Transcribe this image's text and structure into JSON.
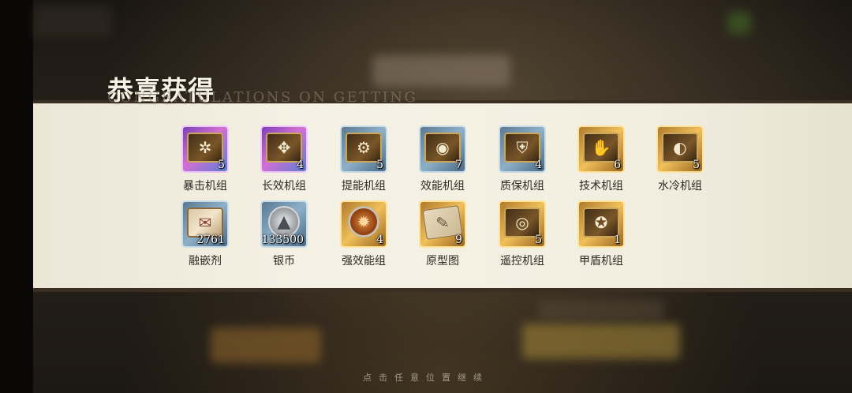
{
  "header": {
    "title": "恭喜获得",
    "subtitle": "CONGRATULATIONS ON GETTING"
  },
  "rewards": [
    {
      "name": "暴击机组",
      "count": "5",
      "rarity": "purple",
      "icon": "critical-module-icon",
      "glyph": "✲"
    },
    {
      "name": "长效机组",
      "count": "4",
      "rarity": "purple",
      "icon": "longevity-module-icon",
      "glyph": "✥"
    },
    {
      "name": "提能机组",
      "count": "5",
      "rarity": "blue",
      "icon": "boost-module-icon",
      "glyph": "⚙"
    },
    {
      "name": "效能机组",
      "count": "7",
      "rarity": "blue",
      "icon": "efficiency-module-icon",
      "glyph": "◉"
    },
    {
      "name": "质保机组",
      "count": "4",
      "rarity": "blue",
      "icon": "warranty-module-icon",
      "glyph": "⛨"
    },
    {
      "name": "技术机组",
      "count": "6",
      "rarity": "gold",
      "icon": "tech-module-icon",
      "glyph": "✋"
    },
    {
      "name": "水冷机组",
      "count": "5",
      "rarity": "gold",
      "icon": "watercool-module-icon",
      "glyph": "◐"
    },
    {
      "name": "融嵌剂",
      "count": "2761",
      "rarity": "blue",
      "icon": "fusion-agent-scroll-icon",
      "glyph": "✉"
    },
    {
      "name": "银币",
      "count": "133500",
      "rarity": "blue",
      "icon": "silver-coin-icon",
      "glyph": "▲"
    },
    {
      "name": "强效能组",
      "count": "4",
      "rarity": "gold",
      "icon": "strong-efficiency-gear-icon",
      "glyph": "✹"
    },
    {
      "name": "原型图",
      "count": "9",
      "rarity": "gold",
      "icon": "blueprint-icon",
      "glyph": "✎"
    },
    {
      "name": "遥控机组",
      "count": "5",
      "rarity": "gold",
      "icon": "remote-module-icon",
      "glyph": "◎"
    },
    {
      "name": "甲盾机组",
      "count": "1",
      "rarity": "gold",
      "icon": "armor-shield-module-icon",
      "glyph": "✪"
    }
  ],
  "footer": {
    "hint": "点击任意位置继续"
  }
}
